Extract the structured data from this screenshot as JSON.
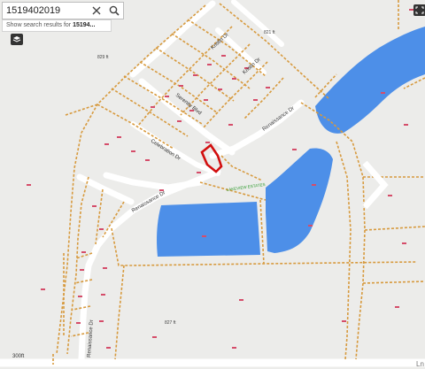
{
  "search": {
    "value": "1519402019",
    "suggestion_prefix": "Show search results for ",
    "suggestion_term": "15194..."
  },
  "map": {
    "streets": [
      {
        "id": "kristin-dr-1",
        "name": "Kristin Dr"
      },
      {
        "id": "kristin-dr-2",
        "name": "Kristin Dr"
      },
      {
        "id": "serenity-blvd",
        "name": "Serenity Blvd"
      },
      {
        "id": "renaissance-dr-ne",
        "name": "Renaissance Dr"
      },
      {
        "id": "celebration-dr",
        "name": "Celebration Dr"
      },
      {
        "id": "renaissance-dr-sw",
        "name": "Renaissance Dr"
      },
      {
        "id": "renaissance-dr-s",
        "name": "Renaissance Dr"
      }
    ],
    "elevations": [
      "821 ft",
      "829 ft",
      "827 ft"
    ],
    "green_label": "LAKEVIEW ESTATES",
    "scale": "300ft",
    "bottom_road": "Ln"
  },
  "icons": {
    "search": "search-icon",
    "clear": "close-icon",
    "layers": "layers-icon",
    "expand": "expand-icon",
    "next": "chevron-right-icon"
  },
  "colors": {
    "background": "#ececea",
    "water": "#4d8fe8",
    "parcel_line": "#d79a3e",
    "road": "#ffffff",
    "selected_parcel": "#d20f0f",
    "parcel_id": "#d54d6a"
  }
}
